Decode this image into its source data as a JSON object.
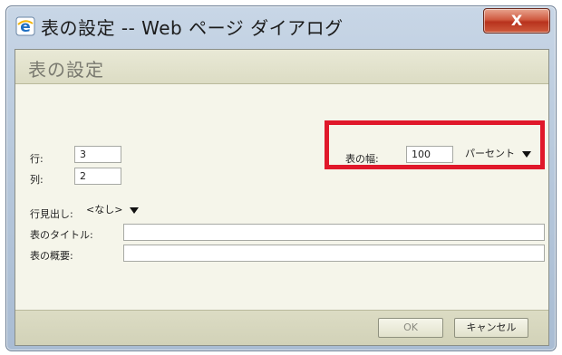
{
  "window": {
    "title": "表の設定 -- Web ページ ダイアログ",
    "close_label": "X"
  },
  "panel": {
    "title": "表の設定"
  },
  "form": {
    "rows_label": "行:",
    "rows_value": "3",
    "cols_label": "列:",
    "cols_value": "2",
    "width_label": "表の幅:",
    "width_value": "100",
    "width_unit": "パーセント",
    "header_label": "行見出し:",
    "header_value": "<なし>",
    "caption_label": "表のタイトル:",
    "caption_value": "",
    "summary_label": "表の概要:",
    "summary_value": ""
  },
  "buttons": {
    "ok": "OK",
    "cancel": "キャンセル"
  },
  "colors": {
    "highlight": "#e0182a",
    "close_button": "#c94a2f"
  },
  "icons": {
    "app": "internet-explorer-icon",
    "dropdown": "triangle-down-icon"
  }
}
